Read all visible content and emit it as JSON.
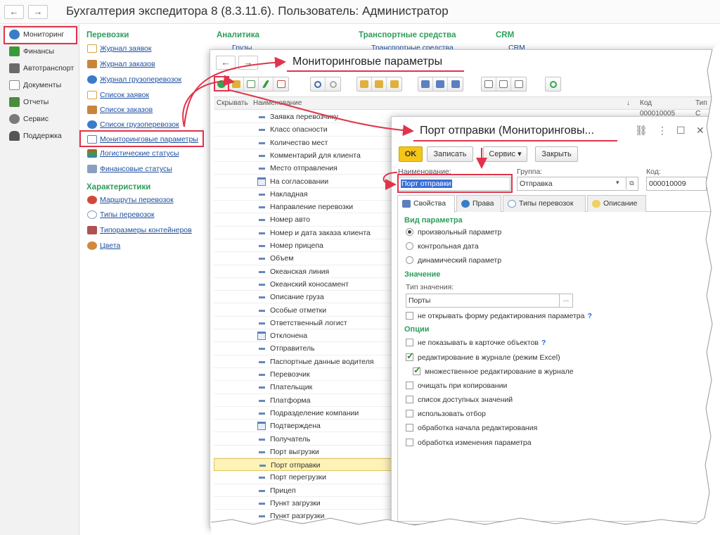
{
  "app": {
    "title": "Бухгалтерия экспедитора 8 (8.3.11.6). Пользователь: Администратор",
    "nav_back": "←",
    "nav_forward": "→"
  },
  "sections": [
    {
      "label": "Мониторинг",
      "icon": "globe-icon",
      "color": "#3a7cc8"
    },
    {
      "label": "Финансы",
      "icon": "coins-icon",
      "color": "#3a9a3a"
    },
    {
      "label": "Автотранспорт",
      "icon": "truck-icon",
      "color": "#6b6b6b"
    },
    {
      "label": "Документы",
      "icon": "document-icon",
      "color": "#8a8a8a"
    },
    {
      "label": "Отчеты",
      "icon": "chart-icon",
      "color": "#4d8c3f"
    },
    {
      "label": "Сервис",
      "icon": "gear-icon",
      "color": "#7a7a7a"
    },
    {
      "label": "Поддержка",
      "icon": "headset-icon",
      "color": "#555555"
    }
  ],
  "groups": {
    "transport": {
      "title": "Перевозки",
      "links": [
        {
          "label": "Журнал заявок",
          "color": "#d9a441"
        },
        {
          "label": "Журнал заказов",
          "color": "#c9853c"
        },
        {
          "label": "Журнал грузоперевозок",
          "color": "#3a7cc8"
        },
        {
          "label": "Список заявок",
          "color": "#d9a441"
        },
        {
          "label": "Список заказов",
          "color": "#c9853c"
        },
        {
          "label": "Список грузоперевозок",
          "color": "#3a7cc8"
        },
        {
          "label": "Мониторинговые параметры",
          "color": "#5b7fc0"
        },
        {
          "label": "Логистические статусы",
          "color": "#3aa03a"
        },
        {
          "label": "Финансовые статусы",
          "color": "#8aa0c0"
        }
      ]
    },
    "characteristics": {
      "title": "Характеристики",
      "links": [
        {
          "label": "Маршруты перевозок",
          "color": "#d04a3a"
        },
        {
          "label": "Типы перевозок",
          "color": "#7aa0c8"
        },
        {
          "label": "Типоразмеры контейнеров",
          "color": "#b05050"
        },
        {
          "label": "Цвета",
          "color": "#d08a3a"
        }
      ]
    },
    "analytics": {
      "title": "Аналитика",
      "item": "Грузы"
    },
    "vehicles": {
      "title": "Транспортные средства",
      "item": "Транспортные средства"
    },
    "crm": {
      "title": "CRM",
      "item": "CRM"
    }
  },
  "list_window": {
    "title": "Мониторинговые параметры",
    "columns": {
      "hide": "Скрывать",
      "name": "Наименование",
      "code": "Код",
      "type": "Тип"
    },
    "first_code": "000010005",
    "first_type": "С",
    "rows": [
      {
        "name": "Заявка перевозчику",
        "icon": "dash"
      },
      {
        "name": "Класс опасности",
        "icon": "dash"
      },
      {
        "name": "Количество мест",
        "icon": "dash"
      },
      {
        "name": "Комментарий для клиента",
        "icon": "dash"
      },
      {
        "name": "Место отправления",
        "icon": "dash"
      },
      {
        "name": "На согласовании",
        "icon": "cal"
      },
      {
        "name": "Накладная",
        "icon": "dash"
      },
      {
        "name": "Направление перевозки",
        "icon": "dash"
      },
      {
        "name": "Номер авто",
        "icon": "dash"
      },
      {
        "name": "Номер и дата заказа клиента",
        "icon": "dash"
      },
      {
        "name": "Номер прицепа",
        "icon": "dash"
      },
      {
        "name": "Объем",
        "icon": "dash"
      },
      {
        "name": "Океанская линия",
        "icon": "dash"
      },
      {
        "name": "Океанский коносамент",
        "icon": "dash"
      },
      {
        "name": "Описание груза",
        "icon": "dash"
      },
      {
        "name": "Особые отметки",
        "icon": "dash"
      },
      {
        "name": "Ответственный логист",
        "icon": "dash"
      },
      {
        "name": "Отклонена",
        "icon": "cal"
      },
      {
        "name": "Отправитель",
        "icon": "dash"
      },
      {
        "name": "Паспортные данные водителя",
        "icon": "dash"
      },
      {
        "name": "Перевозчик",
        "icon": "dash"
      },
      {
        "name": "Плательщик",
        "icon": "dash"
      },
      {
        "name": "Платформа",
        "icon": "dash"
      },
      {
        "name": "Подразделение компании",
        "icon": "dash"
      },
      {
        "name": "Подтверждена",
        "icon": "cal"
      },
      {
        "name": "Получатель",
        "icon": "dash"
      },
      {
        "name": "Порт выгрузки",
        "icon": "dash"
      },
      {
        "name": "Порт отправки",
        "icon": "dash",
        "selected": true
      },
      {
        "name": "Порт перегрузки",
        "icon": "dash"
      },
      {
        "name": "Прицеп",
        "icon": "dash"
      },
      {
        "name": "Пункт загрузки",
        "icon": "dash"
      },
      {
        "name": "Пункт разгрузки",
        "icon": "dash"
      }
    ]
  },
  "dialog": {
    "title": "Порт отправки (Мониторинговы...",
    "buttons": {
      "ok": "OK",
      "save": "Записать",
      "service": "Сервис ▾",
      "close": "Закрыть"
    },
    "name_label": "Наименование:",
    "name_value": "Порт отправки",
    "group_label": "Группа:",
    "group_value": "Отправка",
    "code_label": "Код:",
    "code_value": "000010009",
    "tabs": [
      "Свойства",
      "Права",
      "Типы перевозок",
      "Описание"
    ],
    "param_kind_title": "Вид параметра",
    "param_kinds": [
      {
        "label": "произвольный параметр",
        "checked": true
      },
      {
        "label": "контрольная дата",
        "checked": false
      },
      {
        "label": "динамический параметр",
        "checked": false
      }
    ],
    "value_title": "Значение",
    "value_type_label": "Тип значения:",
    "value_type": "Порты",
    "no_edit_form": "не открывать форму редактирования параметра",
    "options_title": "Опции",
    "options": [
      {
        "label": "не показывать в карточке объектов",
        "checked": false,
        "help": true,
        "indent": false
      },
      {
        "label": "редактирование в журнале (режим Excel)",
        "checked": true,
        "help": false,
        "indent": false
      },
      {
        "label": "множественное редактирование в журнале",
        "checked": true,
        "help": false,
        "indent": true
      },
      {
        "label": "очищать при копировании",
        "checked": false,
        "help": false,
        "indent": false
      },
      {
        "label": "список доступных значений",
        "checked": false,
        "help": false,
        "indent": false
      },
      {
        "label": "использовать отбор",
        "checked": false,
        "help": false,
        "indent": false
      },
      {
        "label": "обработка начала  редактирования",
        "checked": false,
        "help": false,
        "indent": false
      },
      {
        "label": "обработка изменения  параметра",
        "checked": false,
        "help": false,
        "indent": false
      }
    ]
  },
  "colors": {
    "accent_red": "#e0344b",
    "group_green": "#2e9e5b",
    "link_blue": "#1d4fa0",
    "ok_yellow": "#f5c518"
  }
}
